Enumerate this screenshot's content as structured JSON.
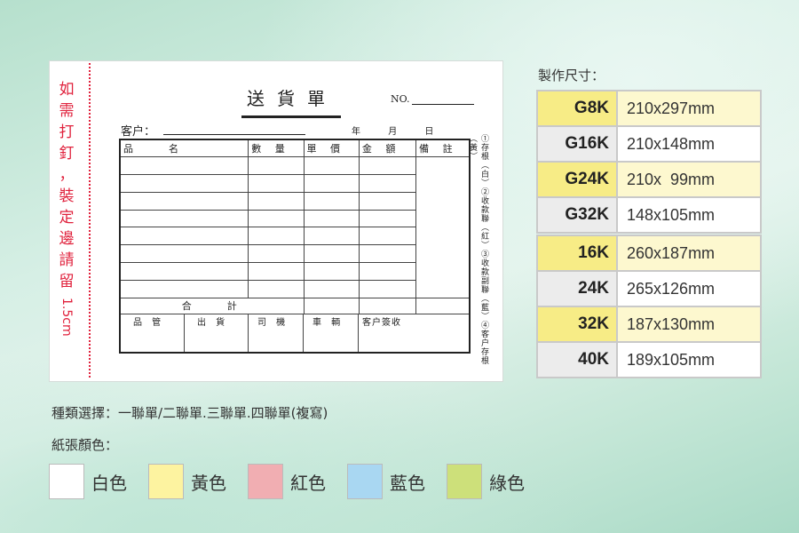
{
  "form": {
    "side_note_chars": [
      "如",
      "需",
      "打",
      "釘",
      "，",
      "裝",
      "定",
      "邊",
      "請",
      "留"
    ],
    "side_note_measure": "1.5cm",
    "title": "送貨單",
    "no_label": "NO.",
    "customer_label": "客户：",
    "date": {
      "year": "年",
      "month": "月",
      "day": "日"
    },
    "headers": [
      "品　　名",
      "數 量",
      "單 價",
      "金 額",
      "備 註"
    ],
    "total_label": "合　　計",
    "sign_labels": [
      "品 管",
      "出 貨",
      "司 機",
      "車 輌",
      "客户簽收"
    ],
    "copies_text": "①存根（白）②收款聯（紅）③收款副聯（藍）④客户存根（黃）"
  },
  "sizes": {
    "heading": "製作尺寸：",
    "group1": [
      {
        "code": "G8K",
        "dim": "210x297mm",
        "code_color": "#f7ec86",
        "dim_color": "#fdf8cf"
      },
      {
        "code": "G16K",
        "dim": "210x148mm",
        "code_color": "#ececec",
        "dim_color": "#ffffff"
      },
      {
        "code": "G24K",
        "dim": "210x  99mm",
        "code_color": "#f7ec86",
        "dim_color": "#fdf8cf"
      },
      {
        "code": "G32K",
        "dim": "148x105mm",
        "code_color": "#ececec",
        "dim_color": "#ffffff"
      }
    ],
    "group2": [
      {
        "code": "16K",
        "dim": "260x187mm",
        "code_color": "#f7ec86",
        "dim_color": "#fdf8cf"
      },
      {
        "code": "24K",
        "dim": "265x126mm",
        "code_color": "#ececec",
        "dim_color": "#ffffff"
      },
      {
        "code": "32K",
        "dim": "187x130mm",
        "code_color": "#f7ec86",
        "dim_color": "#fdf8cf"
      },
      {
        "code": "40K",
        "dim": "189x105mm",
        "code_color": "#ececec",
        "dim_color": "#ffffff"
      }
    ]
  },
  "types_text": "種類選擇：一聯單/二聯單.三聯單.四聯單(複寫)",
  "paper_heading": "紙張顏色：",
  "paper_colors": [
    {
      "label": "白色",
      "color": "#ffffff"
    },
    {
      "label": "黃色",
      "color": "#fdf3a0"
    },
    {
      "label": "紅色",
      "color": "#f1aeb2"
    },
    {
      "label": "藍色",
      "color": "#a9d7f2"
    },
    {
      "label": "綠色",
      "color": "#cde07a"
    }
  ]
}
